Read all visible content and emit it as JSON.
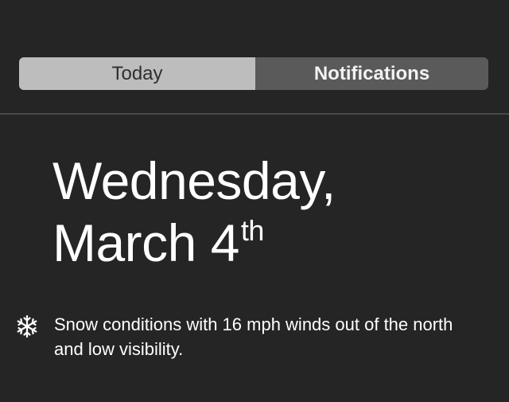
{
  "tabs": {
    "today_label": "Today",
    "notifications_label": "Notifications",
    "selected": "Today"
  },
  "date": {
    "weekday": "Wednesday,",
    "month_day": "March 4",
    "ordinal_suffix": "th"
  },
  "weather": {
    "icon": "snowflake-icon",
    "summary": "Snow conditions with 16 mph winds out of the north and low visibility."
  },
  "colors": {
    "background": "#252525",
    "selected_tab": "#bdbdbd",
    "unselected_tab": "#5a5a5a",
    "text": "#ffffff"
  }
}
